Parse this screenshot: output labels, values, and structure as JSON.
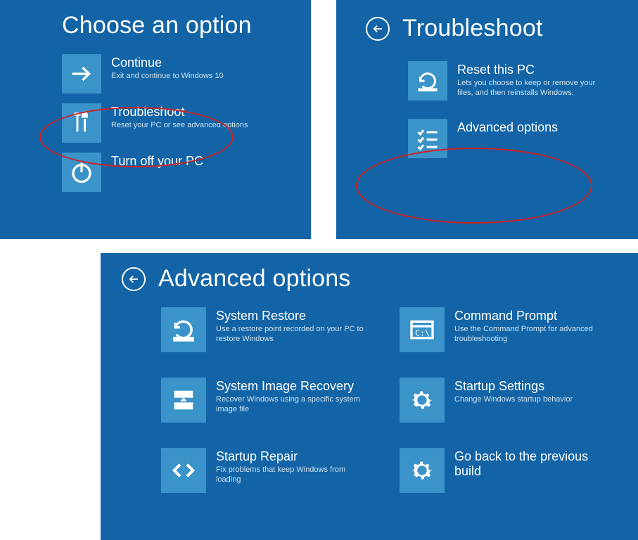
{
  "panel1": {
    "title": "Choose an option",
    "tiles": [
      {
        "title": "Continue",
        "sub": "Exit and continue to Windows 10"
      },
      {
        "title": "Troubleshoot",
        "sub": "Reset your PC or see advanced options"
      },
      {
        "title": "Turn off your PC",
        "sub": ""
      }
    ]
  },
  "panel2": {
    "title": "Troubleshoot",
    "tiles": [
      {
        "title": "Reset this PC",
        "sub": "Lets you choose to keep or remove your files, and then reinstalls Windows."
      },
      {
        "title": "Advanced options",
        "sub": ""
      }
    ]
  },
  "panel3": {
    "title": "Advanced options",
    "left": [
      {
        "title": "System Restore",
        "sub": "Use a restore point recorded on your PC to restore Windows"
      },
      {
        "title": "System Image Recovery",
        "sub": "Recover Windows using a specific system image file"
      },
      {
        "title": "Startup Repair",
        "sub": "Fix problems that keep Windows from loading"
      }
    ],
    "right": [
      {
        "title": "Command Prompt",
        "sub": "Use the Command Prompt for advanced troubleshooting"
      },
      {
        "title": "Startup Settings",
        "sub": "Change Windows startup behavior"
      },
      {
        "title": "Go back to the previous build",
        "sub": ""
      }
    ]
  }
}
